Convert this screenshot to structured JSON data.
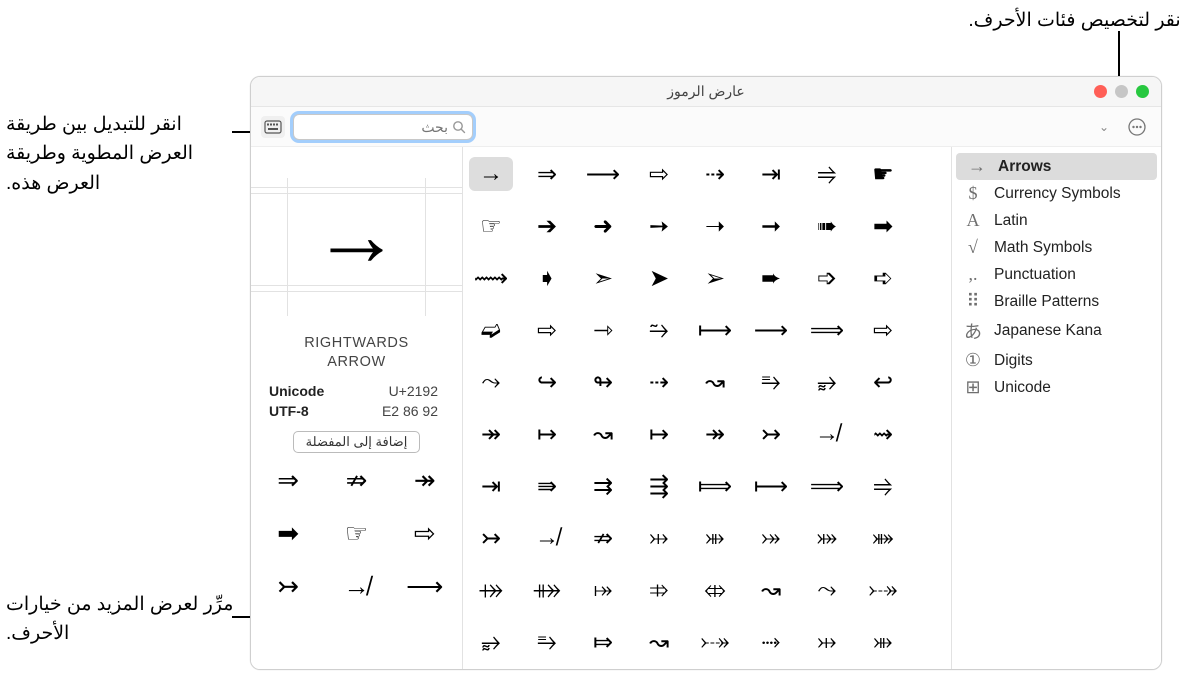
{
  "annotations": {
    "top": "انقر لتخصيص فئات الأحرف.",
    "left1": "انقر للتبديل بين طريقة العرض المطوية وطريقة العرض هذه.",
    "left2": "مرِّر لعرض المزيد من خيارات الأحرف."
  },
  "window": {
    "title": "عارض الرموز"
  },
  "toolbar": {
    "search_placeholder": "بحث"
  },
  "sidebar": {
    "categories": [
      {
        "label": "Arrows",
        "glyph": "→",
        "selected": true
      },
      {
        "label": "Currency Symbols",
        "glyph": "$",
        "selected": false
      },
      {
        "label": "Latin",
        "glyph": "A",
        "selected": false
      },
      {
        "label": "Math Symbols",
        "glyph": "√",
        "selected": false
      },
      {
        "label": "Punctuation",
        "glyph": ".,",
        "selected": false
      },
      {
        "label": "Braille Patterns",
        "glyph": "⠿",
        "selected": false
      },
      {
        "label": "Japanese Kana",
        "glyph": "あ",
        "selected": false
      },
      {
        "label": "Digits",
        "glyph": "①",
        "selected": false
      },
      {
        "label": "Unicode",
        "glyph": "⊞",
        "selected": false
      }
    ]
  },
  "grid": [
    [
      "→",
      "⇒",
      "⟶",
      "⇨",
      "⇢",
      "⇥",
      "⥤",
      "☛"
    ],
    [
      "☞",
      "➔",
      "➜",
      "➙",
      "➝",
      "➞",
      "➠",
      "➡"
    ],
    [
      "⟿",
      "➧",
      "➣",
      "➤",
      "➢",
      "➨",
      "➩",
      "➪"
    ],
    [
      "➫",
      "⇨",
      "⇾",
      "⥲",
      "⟼",
      "⟶",
      "⟹",
      "⇨"
    ],
    [
      "⤳",
      "↪",
      "↬",
      "⇢",
      "↝",
      "⥱",
      "⥵",
      "↩"
    ],
    [
      "↠",
      "↦",
      "↝",
      "↦",
      "↠",
      "↣",
      "↛",
      "⇝"
    ],
    [
      "⇥",
      "⇛",
      "⇉",
      "⇶",
      "⟾",
      "⟼",
      "⟹",
      "⥤"
    ],
    [
      "↣",
      "↛",
      "⇏",
      "⤔",
      "⤕",
      "⤖",
      "⤗",
      "⤘"
    ],
    [
      "⤀",
      "⤁",
      "⤅",
      "⤃",
      "⤄",
      "↝",
      "⤳",
      "⤐"
    ],
    [
      "⥵",
      "⥱",
      "⤇",
      "↝",
      "⤐",
      "⤑",
      "⤔",
      "⤕"
    ]
  ],
  "inspector": {
    "glyph": "→",
    "name": "RIGHTWARDS\nARROW",
    "unicode_label": "Unicode",
    "unicode_value": "U+2192",
    "utf8_label": "UTF-8",
    "utf8_value": "E2 86 92",
    "fav_button": "إضافة إلى المفضلة",
    "variants": [
      "⇒",
      "⇏",
      "↠",
      "➡",
      "☞",
      "⇨",
      "↣",
      "↛",
      "⟶"
    ]
  }
}
